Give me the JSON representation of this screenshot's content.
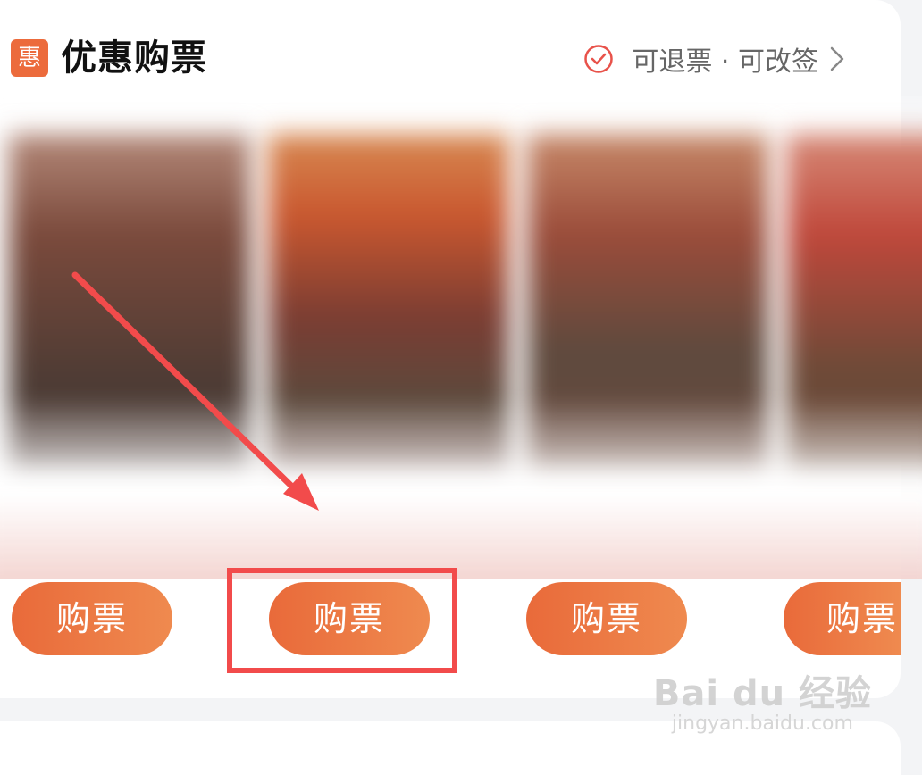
{
  "section": {
    "badge": "惠",
    "title": "优惠购票",
    "policy_text": "可退票 · 可改签"
  },
  "posters": [
    {
      "palette": [
        "#7b4a3c",
        "#4c3b34"
      ]
    },
    {
      "palette": [
        "#c9572f",
        "#6f3d3a"
      ]
    },
    {
      "palette": [
        "#9b4c3a",
        "#4f4038"
      ]
    },
    {
      "palette": [
        "#c0483b",
        "#5c3a30"
      ]
    }
  ],
  "buy_buttons": [
    {
      "label": "购票"
    },
    {
      "label": "购票"
    },
    {
      "label": "购票"
    },
    {
      "label": "购票"
    }
  ],
  "annotations": {
    "arrow_color": "#f24b4b",
    "highlight_color": "#f24b4b"
  },
  "watermark": {
    "main": "Bai du 经验",
    "sub": "jingyan.baidu.com"
  },
  "colors": {
    "accent": "#ec6b3c",
    "button_start": "#e96a3a",
    "button_end": "#ef8a4f"
  }
}
